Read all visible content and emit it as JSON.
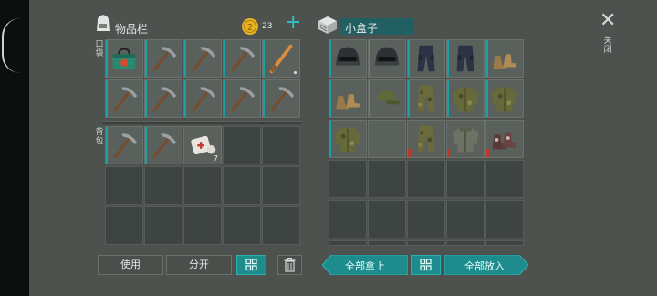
{
  "inventory": {
    "title": "物品栏",
    "coin_count": "23",
    "add_label": "+",
    "pocket_label": "口袋",
    "backpack_label": "背包"
  },
  "container": {
    "title": "小盒子",
    "close_label": "关闭"
  },
  "buttons": {
    "use": "使用",
    "split": "分开",
    "take_all": "全部拿上",
    "put_all": "全部放入"
  },
  "items": {
    "bandage_count": "7"
  },
  "colors": {
    "panel": "#4d524f",
    "accent_teal": "#1aa0a5",
    "coin": "#e8b321",
    "durability_red": "#c2392a"
  }
}
